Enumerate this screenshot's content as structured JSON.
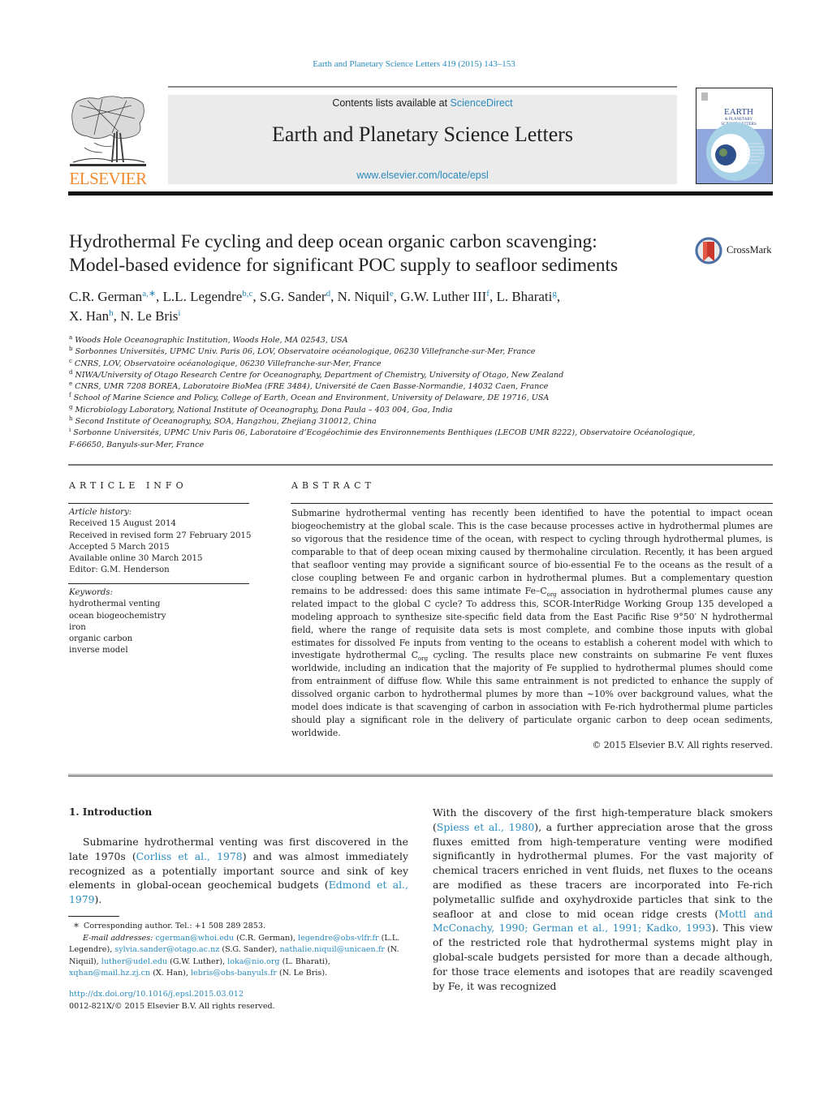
{
  "header": {
    "journal_ref": "Earth and Planetary Science Letters 419 (2015) 143–153",
    "contents_prefix": "Contents lists available at ",
    "contents_link": "ScienceDirect",
    "journal_name": "Earth and Planetary Science Letters",
    "journal_url": "www.elsevier.com/locate/epsl",
    "publisher": "ELSEVIER",
    "cover_title_line1": "EARTH",
    "cover_title_line2": "& PLANETARY",
    "cover_title_line3": "SCIENCE LETTERS",
    "brand_orange": "#f08a2c",
    "link_blue": "#2a8bbf"
  },
  "article": {
    "title_line1": "Hydrothermal Fe cycling and deep ocean organic carbon scavenging:",
    "title_line2": "Model-based evidence for significant POC supply to seafloor sediments",
    "crossmark_label": "CrossMark",
    "authors": [
      {
        "name": "C.R. German",
        "sup": "a,∗",
        "sep": ", "
      },
      {
        "name": "L.L. Legendre",
        "sup": "b,c",
        "sep": ", "
      },
      {
        "name": "S.G. Sander",
        "sup": "d",
        "sep": ", "
      },
      {
        "name": "N. Niquil",
        "sup": "e",
        "sep": ", "
      },
      {
        "name": "G.W. Luther III",
        "sup": "f",
        "sep": ", "
      },
      {
        "name": "L. Bharati",
        "sup": "g",
        "sep": ","
      },
      {
        "name": "X. Han",
        "sup": "h",
        "sep": ", "
      },
      {
        "name": "N. Le Bris",
        "sup": "i",
        "sep": ""
      }
    ],
    "affiliations": [
      {
        "key": "a",
        "text": "Woods Hole Oceanographic Institution, Woods Hole, MA 02543, USA"
      },
      {
        "key": "b",
        "text": "Sorbonnes Universités, UPMC Univ. Paris 06, LOV, Observatoire océanologique, 06230 Villefranche-sur-Mer, France"
      },
      {
        "key": "c",
        "text": "CNRS, LOV, Observatoire océanologique, 06230 Villefranche-sur-Mer, France"
      },
      {
        "key": "d",
        "text": "NIWA/University of Otago Research Centre for Oceanography, Department of Chemistry, University of Otago, New Zealand"
      },
      {
        "key": "e",
        "text": "CNRS, UMR 7208 BOREA, Laboratoire BioMea (FRE 3484), Université de Caen Basse-Normandie, 14032 Caen, France"
      },
      {
        "key": "f",
        "text": "School of Marine Science and Policy, College of Earth, Ocean and Environment, University of Delaware, DE 19716, USA"
      },
      {
        "key": "g",
        "text": "Microbiology Laboratory, National Institute of Oceanography, Dona Paula – 403 004, Goa, India"
      },
      {
        "key": "h",
        "text": "Second Institute of Oceanography, SOA, Hangzhou, Zhejiang 310012, China"
      },
      {
        "key": "i",
        "text": "Sorbonne Universités, UPMC Univ Paris 06, Laboratoire d’Ecogéochimie des Environnements Benthiques (LECOB UMR 8222), Observatoire Océanologique,"
      },
      {
        "key": "",
        "text": "F-66650, Banyuls-sur-Mer, France"
      }
    ]
  },
  "article_info": {
    "heading": "ARTICLE INFO",
    "history_label": "Article history:",
    "history": [
      "Received 15 August 2014",
      "Received in revised form 27 February 2015",
      "Accepted 5 March 2015",
      "Available online 30 March 2015",
      "Editor: G.M. Henderson"
    ],
    "keywords_label": "Keywords:",
    "keywords": [
      "hydrothermal venting",
      "ocean biogeochemistry",
      "iron",
      "organic carbon",
      "inverse model"
    ]
  },
  "abstract": {
    "heading": "ABSTRACT",
    "part1": "Submarine hydrothermal venting has recently been identified to have the potential to impact ocean biogeochemistry at the global scale. This is the case because processes active in hydrothermal plumes are so vigorous that the residence time of the ocean, with respect to cycling through hydrothermal plumes, is comparable to that of deep ocean mixing caused by thermohaline circulation. Recently, it has been argued that seafloor venting may provide a significant source of bio-essential Fe to the oceans as the result of a close coupling between Fe and organic carbon in hydrothermal plumes. But a complementary question remains to be addressed: does this same intimate Fe–C",
    "sub1": "org",
    "part2": " association in hydrothermal plumes cause any related impact to the global C cycle? To address this, SCOR-InterRidge Working Group 135 developed a modeling approach to synthesize site-specific field data from the East Pacific Rise 9°50′ N hydrothermal field, where the range of requisite data sets is most complete, and combine those inputs with global estimates for dissolved Fe inputs from venting to the oceans to establish a coherent model with which to investigate hydrothermal C",
    "sub2": "org",
    "part3": " cycling. The results place new constraints on submarine Fe vent fluxes worldwide, including an indication that the majority of Fe supplied to hydrothermal plumes should come from entrainment of diffuse flow. While this same entrainment is not predicted to enhance the supply of dissolved organic carbon to hydrothermal plumes by more than ∼10% over background values, what the model does indicate is that scavenging of carbon in association with Fe-rich hydrothermal plume particles should play a significant role in the delivery of particulate organic carbon to deep ocean sediments, worldwide.",
    "copyright": "© 2015 Elsevier B.V. All rights reserved."
  },
  "introduction": {
    "heading": "1. Introduction",
    "left_p1_a": "Submarine hydrothermal venting was first discovered in the late 1970s (",
    "left_ref1": "Corliss et al., 1978",
    "left_p1_b": ") and was almost immediately recognized as a potentially important source and sink of key elements in global-ocean geochemical budgets (",
    "left_ref2": "Edmond et al., 1979",
    "left_p1_c": ").",
    "right_a": "With the discovery of the first high-temperature black smokers (",
    "right_ref1": "Spiess et al., 1980",
    "right_b": "), a further appreciation arose that the gross fluxes emitted from high-temperature venting were modified significantly in hydrothermal plumes. For the vast majority of chemical tracers enriched in vent fluids, net fluxes to the oceans are modified as these tracers are incorporated into Fe-rich polymetallic sulfide and oxyhydroxide particles that sink to the seafloor at and close to mid ocean ridge crests (",
    "right_ref2": "Mottl and McConachy, 1990; German et al., 1991; Kadko, 1993",
    "right_c": "). This view of the restricted role that hydrothermal systems might play in global-scale budgets persisted for more than a decade although, for those trace elements and isotopes that are readily scavenged by Fe, it was recognized"
  },
  "footnotes": {
    "star": "∗",
    "corresponding": "Corresponding author. Tel.: +1 508 289 2853.",
    "email_label": "E-mail addresses:",
    "emails": [
      {
        "email": "cgerman@whoi.edu",
        "who": " (C.R. German), "
      },
      {
        "email": "legendre@obs-vlfr.fr",
        "who": " (L.L. Legendre), "
      },
      {
        "email": "sylvia.sander@otago.ac.nz",
        "who": " (S.G. Sander), "
      },
      {
        "email": "nathalie.niquil@unicaen.fr",
        "who": " (N. Niquil), "
      },
      {
        "email": "luther@udel.edu",
        "who": " (G.W. Luther), "
      },
      {
        "email": "loka@nio.org",
        "who": " (L. Bharati), "
      },
      {
        "email": "xqhan@mail.hz.zj.cn",
        "who": " (X. Han), "
      },
      {
        "email": "lebris@obs-banyuls.fr",
        "who": " (N. Le Bris)."
      }
    ],
    "doi": "http://dx.doi.org/10.1016/j.epsl.2015.03.012",
    "issn": "0012-821X/© 2015 Elsevier B.V. All rights reserved."
  }
}
